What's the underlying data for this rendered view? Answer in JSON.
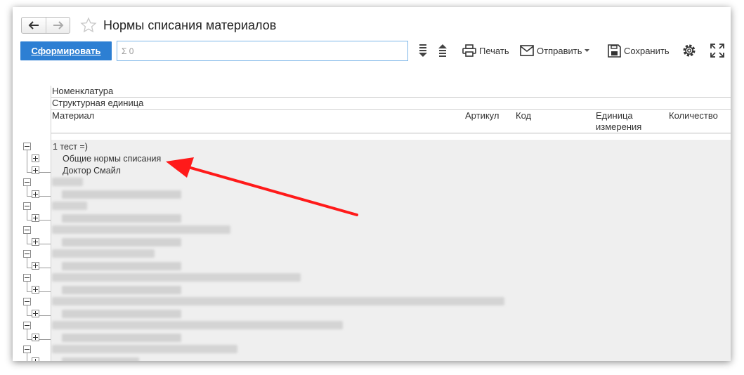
{
  "header": {
    "title": "Нормы списания материалов"
  },
  "toolbar": {
    "form_button": "Сформировать",
    "search_placeholder": "Σ 0",
    "print_label": "Печать",
    "send_label": "Отправить",
    "save_label": "Сохранить"
  },
  "report": {
    "col_nomenclature": "Номенклатура",
    "col_struct_unit": "Структурная единица",
    "col_material": "Материал",
    "col_article": "Артикул",
    "col_code": "Код",
    "col_unit": "Единица измерения",
    "col_quantity": "Количество",
    "group_label": "1 тест =)",
    "item_1": "Общие нормы списания",
    "item_2": "Доктор Смайл"
  },
  "colors": {
    "accent": "#2d7fd3",
    "arrow": "#ff1a1a",
    "grid_bg": "#efefef"
  }
}
